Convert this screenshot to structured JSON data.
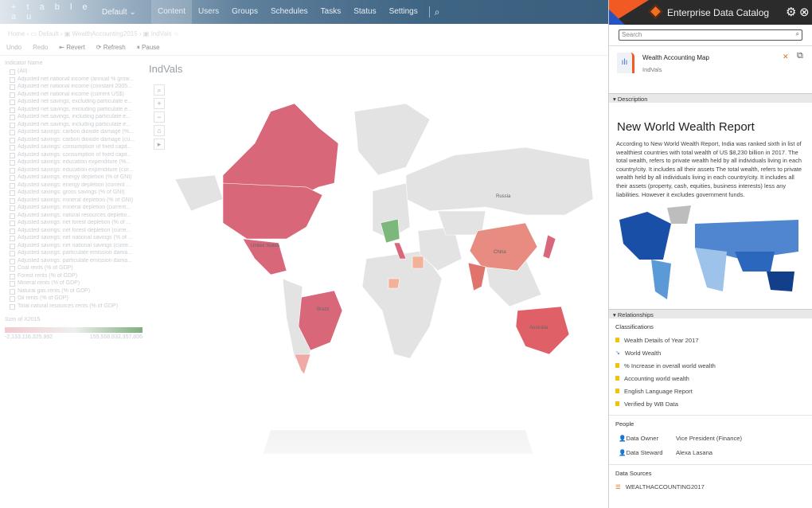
{
  "topbar": {
    "logo": "+ t a b l e a u",
    "site": "Default",
    "nav": [
      "Content",
      "Users",
      "Groups",
      "Schedules",
      "Tasks",
      "Status",
      "Settings"
    ],
    "active": "Content"
  },
  "breadcrumb": [
    "Home",
    "Default",
    "WealthAccounting2015",
    "IndVals"
  ],
  "toolbar": [
    "Undo",
    "Redo",
    "Revert",
    "Refresh",
    "Pause"
  ],
  "sidebar": {
    "header": "Indicator Name",
    "items": [
      "(All)",
      "Adjusted net national income (annual % grow...",
      "Adjusted net national income (constant 2005...",
      "Adjusted net national income (current US$)",
      "Adjusted net savings, excluding particulate e...",
      "Adjusted net savings, excluding particulate e...",
      "Adjusted net savings, including particulate e...",
      "Adjusted net savings, including particulate e...",
      "Adjusted savings: carbon dioxide damage (%...",
      "Adjusted savings: carbon dioxide damage (cu...",
      "Adjusted savings: consumption of fixed capit...",
      "Adjusted savings: consumption of fixed capit...",
      "Adjusted savings: education expenditure (%...",
      "Adjusted savings: education expenditure (cur...",
      "Adjusted savings: energy depletion (% of GNI)",
      "Adjusted savings: energy depletion (current ...",
      "Adjusted savings: gross savings (% of GNI)",
      "Adjusted savings: mineral depletion (% of GNI)",
      "Adjusted savings: mineral depletion (current...",
      "Adjusted savings: natural resources depletio...",
      "Adjusted savings: net forest depletion (% of ...",
      "Adjusted savings: net forest depletion (curre...",
      "Adjusted savings: net national savings (% of ...",
      "Adjusted savings: net national savings (curre...",
      "Adjusted savings: particulate emission dama...",
      "Adjusted savings: particulate emission dama...",
      "Coal rents (% of GDP)",
      "Forest rents (% of GDP)",
      "Mineral rents (% of GDP)",
      "Natural gas rents (% of GDP)",
      "Oil rents (% of GDP)",
      "Total natural resources rents (% of GDP)"
    ],
    "legend_title": "Sum of X2015",
    "legend_min": "-2,133,116,325,992",
    "legend_max": "155,558,832,357,806"
  },
  "viz": {
    "title": "IndVals",
    "labels": {
      "russia": "Russia",
      "us": "United States",
      "brazil": "Brazil",
      "china": "China",
      "australia": "Australia"
    }
  },
  "panel": {
    "title": "Enterprise Data Catalog",
    "search_placeholder": "Search",
    "asset_name": "Wealth Accounting Map",
    "asset_sub": "IndVals",
    "description_label": "Description",
    "heading": "New World Wealth Report",
    "text": "According to New World Wealth Report, India was ranked sixth in list of wealthiest countries with total wealth of US $8,230 billion in 2017. The total wealth, refers to private wealth held by all individuals living in each country/city. It includes all their assets The total wealth, refers to private wealth held by all individuals living in each country/city. It includes all their assets (property, cash, equities, business interests) less any liabilities. However it excludes government funds.",
    "relationships_label": "Relationships",
    "classifications_label": "Classifications",
    "classifications": [
      "Wealth Details of Year 2017",
      "World Wealth",
      "% Increase in overall world wealth",
      "Accounting world wealth",
      "English Language Report",
      "Verified by WB Data"
    ],
    "people_label": "People",
    "people": [
      {
        "role": "Data Owner",
        "name": "Vice President (Finance)"
      },
      {
        "role": "Data Steward",
        "name": "Alexa Lasana"
      }
    ],
    "sources_label": "Data Sources",
    "sources": [
      "WEALTHACCOUNTING2017"
    ]
  },
  "colors": {
    "accent": "#f15a22",
    "nav": "#3b5f7e",
    "red": "#d9677a",
    "green": "#7cb87c"
  }
}
